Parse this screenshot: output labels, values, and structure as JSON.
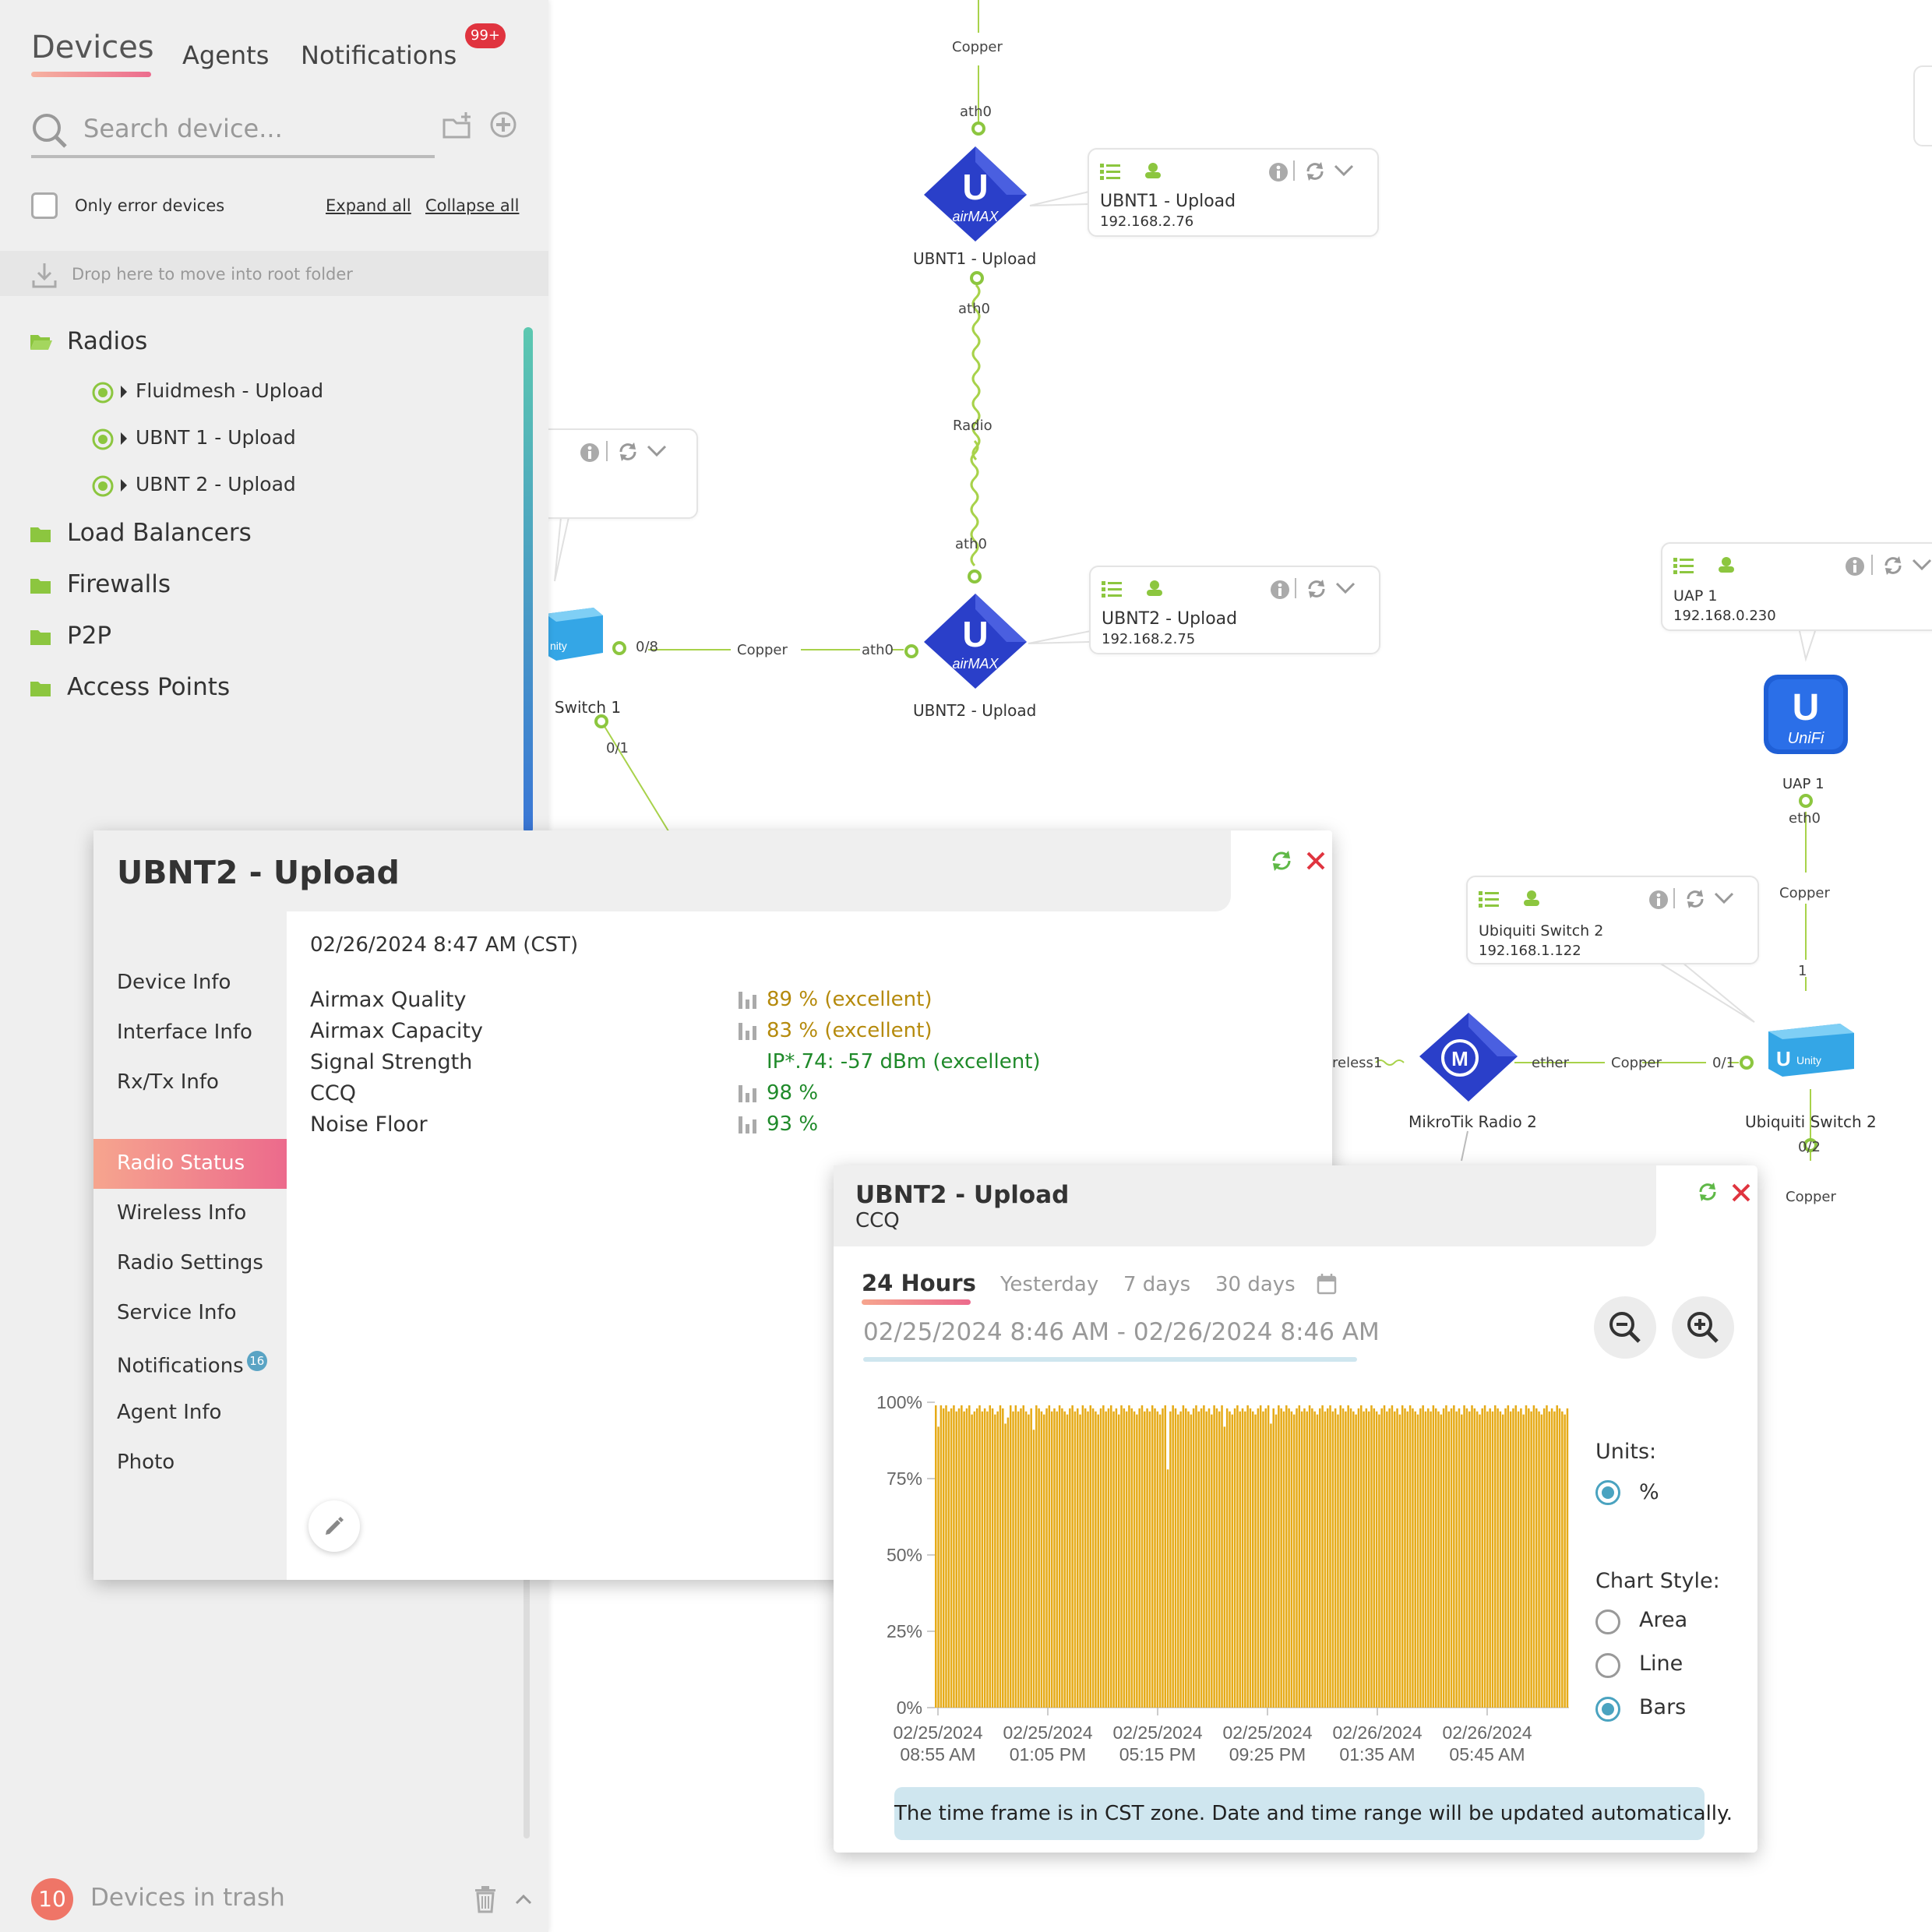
{
  "tabs": {
    "devices": "Devices",
    "agents": "Agents",
    "notifications": "Notifications",
    "notifications_badge": "99+"
  },
  "search": {
    "placeholder": "Search device..."
  },
  "filters": {
    "only_error": "Only error devices",
    "expand_all": "Expand all",
    "collapse_all": "Collapse all"
  },
  "drop_hint": "Drop here to move into root folder",
  "tree": {
    "folders": [
      "Radios",
      "Load Balancers",
      "Firewalls",
      "P2P",
      "Access Points"
    ],
    "radios": [
      "Fluidmesh - Upload",
      "UBNT 1 - Upload",
      "UBNT 2 - Upload"
    ]
  },
  "trash": {
    "count": "10",
    "label": "Devices in trash"
  },
  "map": {
    "nodes": {
      "ubnt1": "UBNT1 - Upload",
      "ubnt2": "UBNT2 - Upload",
      "switch1": "i Switch 1",
      "uap1": "UAP 1",
      "mikrotik2": "MikroTik Radio 2",
      "switch2": "Ubiquiti Switch 2"
    },
    "cards": {
      "ubnt1": {
        "name": "UBNT1 - Upload",
        "ip": "192.168.2.76"
      },
      "ubnt2": {
        "name": "UBNT2 - Upload",
        "ip": "192.168.2.75"
      },
      "uap1": {
        "name": "UAP 1",
        "ip": "192.168.0.230"
      },
      "switch2": {
        "name": "Ubiquiti Switch 2",
        "ip": "192.168.1.122"
      }
    },
    "links": {
      "copper": "Copper",
      "radio": "Radio",
      "ath0": "ath0",
      "eth0": "eth0",
      "ether": "ether",
      "port_08": "0/8",
      "port_01": "0/1",
      "port_02": "0/2",
      "port_1": "1",
      "wireless": "reless1"
    },
    "logos": {
      "airmax": "airMAX",
      "unifi": "UniFi",
      "unity": "Unity",
      "unity_partial": "nity"
    }
  },
  "device_panel": {
    "title": "UBNT2 - Upload",
    "menu": [
      "Device Info",
      "Interface Info",
      "Rx/Tx Info",
      "Radio Status",
      "Wireless Info",
      "Radio Settings",
      "Service Info",
      "Notifications",
      "Agent Info",
      "Photo"
    ],
    "notifications_count": "16",
    "active_item": "Radio Status",
    "timestamp": "02/26/2024 8:47 AM (CST)",
    "radio_status": [
      {
        "label": "Airmax Quality",
        "value": "89 % (excellent)"
      },
      {
        "label": "Airmax Capacity",
        "value": "83 % (excellent)"
      },
      {
        "label": "Signal Strength",
        "value": "IP*.74: -57 dBm (excellent)"
      },
      {
        "label": "CCQ",
        "value": "98 %"
      },
      {
        "label": "Noise Floor",
        "value": "93 %"
      }
    ],
    "colors": {
      "warn": "#b58a0c",
      "good": "#1f8a2a"
    }
  },
  "chart_panel": {
    "title": "UBNT2 - Upload",
    "subtitle": "CCQ",
    "ranges": [
      "24 Hours",
      "Yesterday",
      "7 days",
      "30 days"
    ],
    "active_range": "24 Hours",
    "span": "02/25/2024 8:46 AM - 02/26/2024 8:46 AM",
    "units_label": "Units:",
    "unit_option": "%",
    "style_label": "Chart Style:",
    "style_options": [
      "Area",
      "Line",
      "Bars"
    ],
    "active_style": "Bars",
    "note": "The time frame is in CST zone. Date and time range will be updated automatically."
  },
  "chart_data": {
    "type": "bar",
    "title": "",
    "xlabel": "",
    "ylabel": "",
    "ylim": [
      0,
      100
    ],
    "yticks": [
      "0%",
      "25%",
      "50%",
      "75%",
      "100%"
    ],
    "xticks": [
      [
        "02/25/2024",
        "08:55 AM"
      ],
      [
        "02/25/2024",
        "01:05 PM"
      ],
      [
        "02/25/2024",
        "05:15 PM"
      ],
      [
        "02/25/2024",
        "09:25 PM"
      ],
      [
        "02/26/2024",
        "01:35 AM"
      ],
      [
        "02/26/2024",
        "05:45 AM"
      ]
    ],
    "color": "#e6ab18",
    "values": [
      99,
      92,
      99,
      98,
      99,
      97,
      98,
      99,
      97,
      98,
      99,
      97,
      98,
      99,
      96,
      97,
      98,
      99,
      97,
      98,
      97,
      99,
      98,
      96,
      97,
      99,
      98,
      93,
      95,
      99,
      97,
      99,
      97,
      98,
      99,
      97,
      96,
      98,
      91,
      99,
      98,
      97,
      96,
      98,
      99,
      97,
      98,
      97,
      99,
      98,
      97,
      96,
      98,
      99,
      97,
      98,
      96,
      99,
      98,
      97,
      99,
      98,
      97,
      96,
      98,
      99,
      97,
      98,
      99,
      97,
      98,
      96,
      99,
      98,
      97,
      99,
      98,
      97,
      96,
      98,
      99,
      97,
      98,
      97,
      99,
      98,
      97,
      96,
      98,
      99,
      78,
      97,
      99,
      98,
      96,
      97,
      99,
      98,
      97,
      96,
      98,
      99,
      97,
      98,
      99,
      97,
      98,
      96,
      99,
      98,
      97,
      99,
      92,
      98,
      97,
      96,
      98,
      99,
      97,
      98,
      97,
      99,
      98,
      97,
      96,
      98,
      99,
      97,
      98,
      99,
      93,
      98,
      96,
      99,
      98,
      97,
      99,
      98,
      97,
      96,
      98,
      99,
      97,
      98,
      97,
      99,
      98,
      97,
      96,
      98,
      99,
      97,
      98,
      99,
      97,
      98,
      96,
      99,
      98,
      97,
      99,
      98,
      97,
      96,
      98,
      99,
      97,
      98,
      97,
      99,
      98,
      97,
      96,
      98,
      99,
      97,
      98,
      99,
      97,
      98,
      96,
      99,
      98,
      97,
      99,
      98,
      97,
      96,
      98,
      99,
      97,
      98,
      97,
      99,
      98,
      97,
      96,
      98,
      99,
      97,
      98,
      99,
      97,
      98,
      96,
      99,
      98,
      97,
      99,
      98,
      97,
      96,
      98,
      99,
      97,
      98,
      97,
      99,
      98,
      97,
      96,
      98,
      99,
      97,
      98,
      99,
      97,
      98,
      96,
      99,
      98,
      97,
      99,
      98,
      97,
      96,
      98,
      99,
      97,
      98,
      97,
      99,
      98,
      97,
      96,
      98
    ]
  }
}
